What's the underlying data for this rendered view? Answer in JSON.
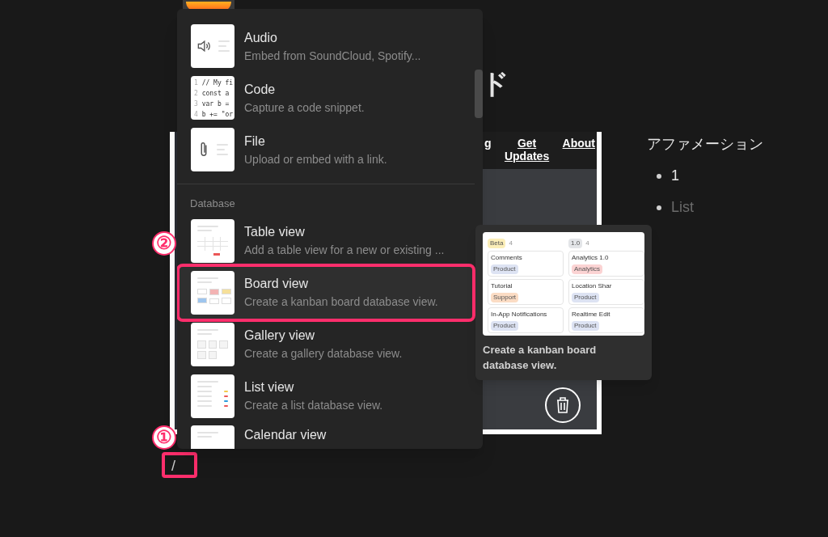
{
  "page": {
    "title_fragment": "ド",
    "slash_input": "/",
    "callout_heading": "アファメーション",
    "bullets": [
      {
        "text": "1",
        "placeholder": false
      },
      {
        "text": "List",
        "placeholder": true
      }
    ]
  },
  "embed": {
    "nav_links": [
      "g",
      "Get Updates",
      "About"
    ]
  },
  "menu": {
    "sections": [
      {
        "items": [
          {
            "kind": "audio",
            "title": "Audio",
            "description": "Embed from SoundCloud, Spotify...",
            "selected": false
          },
          {
            "kind": "code",
            "title": "Code",
            "description": "Capture a code snippet.",
            "selected": false,
            "code_lines": [
              [
                "1",
                "// My fi"
              ],
              [
                "2",
                "const a"
              ],
              [
                "3",
                "var b ="
              ],
              [
                "4",
                "b += \"or"
              ]
            ]
          },
          {
            "kind": "file",
            "title": "File",
            "description": "Upload or embed with a link.",
            "selected": false
          }
        ]
      },
      {
        "heading": "Database",
        "items": [
          {
            "kind": "table",
            "title": "Table view",
            "description": "Add a table view for a new or existing ...",
            "selected": false
          },
          {
            "kind": "board",
            "title": "Board view",
            "description": "Create a kanban board database view.",
            "selected": true
          },
          {
            "kind": "gallery",
            "title": "Gallery view",
            "description": "Create a gallery database view.",
            "selected": false
          },
          {
            "kind": "list",
            "title": "List view",
            "description": "Create a list database view.",
            "selected": false
          },
          {
            "kind": "calendar",
            "title": "Calendar view",
            "selected": false
          }
        ]
      }
    ]
  },
  "tooltip": {
    "description": "Create a kanban board database view.",
    "columns": [
      {
        "tag": "Beta",
        "count": "4",
        "color": "#fbeeb8",
        "cards": [
          {
            "title": "Comments",
            "tag": "Product",
            "color": "#dde3f3"
          },
          {
            "title": "Tutorial",
            "tag": "Support",
            "color": "#fbdcc4"
          },
          {
            "title": "In-App Notifications",
            "tag": "Product",
            "color": "#dde3f3"
          }
        ]
      },
      {
        "tag": "1.0",
        "count": "4",
        "color": "#e3e5e8",
        "cards": [
          {
            "title": "Analytics 1.0",
            "tag": "Analytics",
            "color": "#fbd3d3"
          },
          {
            "title": "Location Shar",
            "tag": "Product",
            "color": "#dde3f3"
          },
          {
            "title": "Realtime Edit",
            "tag": "Product",
            "color": "#dde3f3"
          }
        ]
      }
    ]
  },
  "annotations": [
    {
      "label": "②"
    },
    {
      "label": "①"
    }
  ]
}
